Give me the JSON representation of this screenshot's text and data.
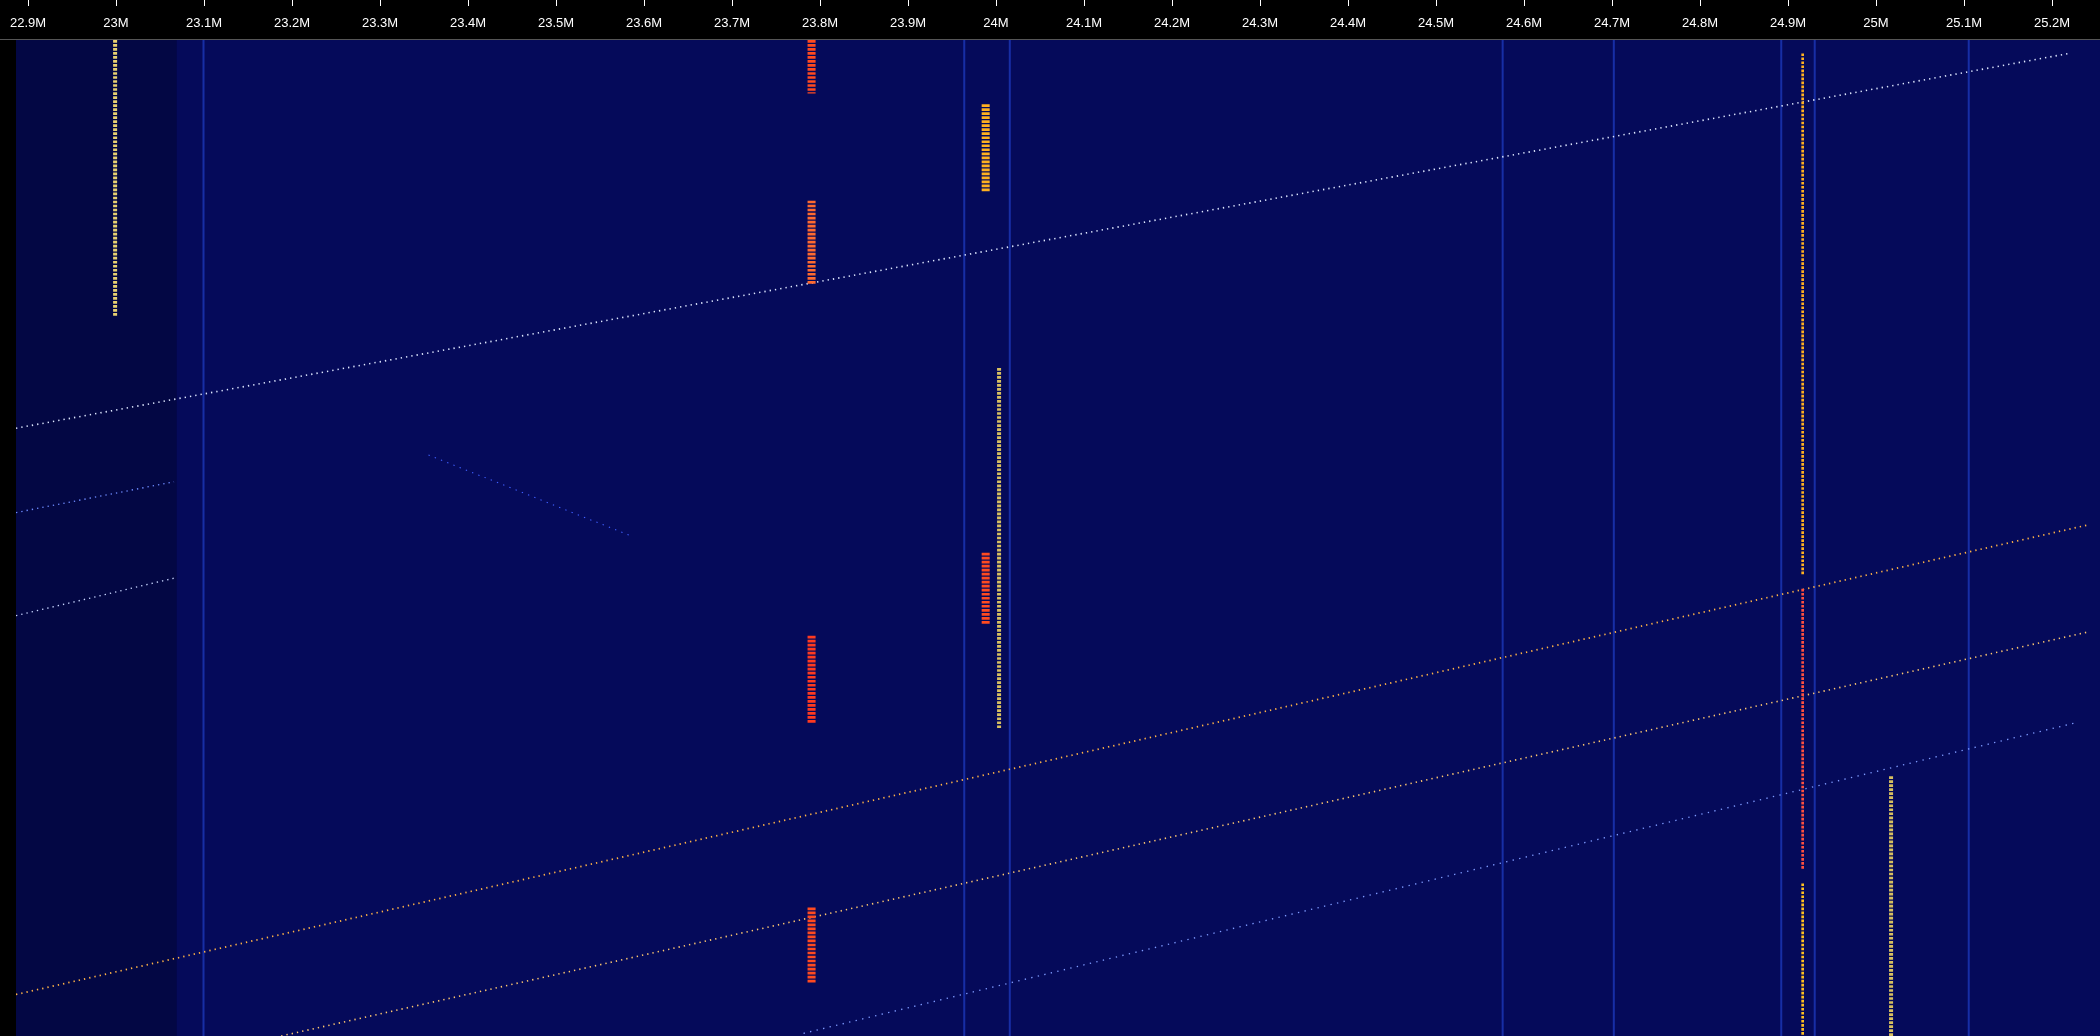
{
  "frequency_axis": {
    "ticks": [
      "22.9M",
      "23M",
      "23.1M",
      "23.2M",
      "23.3M",
      "23.4M",
      "23.5M",
      "23.6M",
      "23.7M",
      "23.8M",
      "23.9M",
      "24M",
      "24.1M",
      "24.2M",
      "24.3M",
      "24.4M",
      "24.5M",
      "24.6M",
      "24.7M",
      "24.8M",
      "24.9M",
      "25M",
      "25.1M",
      "25.2M"
    ]
  }
}
